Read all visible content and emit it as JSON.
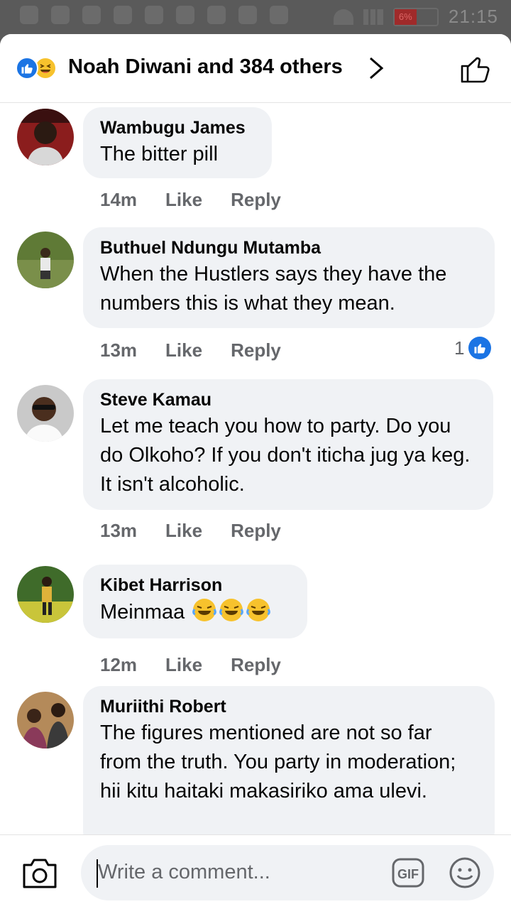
{
  "status_bar": {
    "battery": "6%",
    "time": "21:15"
  },
  "header": {
    "reactions": [
      "like-icon",
      "haha-icon"
    ],
    "title": "Noah Diwani and 384 others"
  },
  "comments": [
    {
      "author": "Wambugu James",
      "text": "The bitter pill",
      "time": "14m",
      "like": "Like",
      "reply": "Reply"
    },
    {
      "author": "Buthuel Ndungu Mutamba",
      "text": "When the Hustlers says they have the numbers this is what they mean.",
      "time": "13m",
      "like": "Like",
      "reply": "Reply",
      "reaction_count": "1"
    },
    {
      "author": "Steve Kamau",
      "text": "Let me teach you how to party. Do you do Olkoho? If you don't iticha jug ya keg. It isn't alcoholic.",
      "time": "13m",
      "like": "Like",
      "reply": "Reply"
    },
    {
      "author": "Kibet Harrison",
      "text": "Meinmaa",
      "emoji": [
        "laughing-crying-emoji",
        "laughing-crying-emoji",
        "laughing-crying-emoji"
      ],
      "time": "12m",
      "like": "Like",
      "reply": "Reply"
    },
    {
      "author": "Muriithi Robert",
      "text": "The figures mentioned are not so far from the truth. You party in moderation; hii kitu haitaki makasiriko ama ulevi."
    }
  ],
  "composer": {
    "placeholder": "Write a comment...",
    "gif_label": "GIF"
  },
  "colors": {
    "accent": "#1b74e4",
    "bubble": "#f0f2f5",
    "meta_text": "#65676b"
  }
}
